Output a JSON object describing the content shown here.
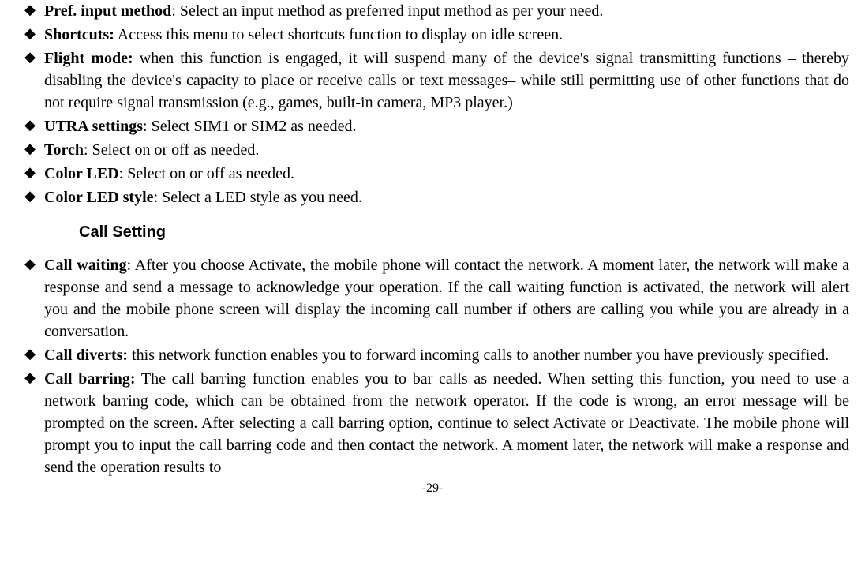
{
  "items1": [
    {
      "label": "Pref. input method",
      "sep": ": ",
      "text": "Select an input method as preferred input method as per your need."
    },
    {
      "label": "Shortcuts:",
      "sep": " ",
      "text": "Access this menu to select shortcuts function to display on idle screen."
    },
    {
      "label": "Flight mode:",
      "sep": " ",
      "text": "when this function is engaged, it will suspend many of the device's signal transmitting functions – thereby disabling the device's capacity to place or receive calls or text messages– while still permitting use of other functions that do not require signal transmission (e.g., games, built-in camera, MP3 player.)"
    },
    {
      "label": "UTRA settings",
      "sep": ": ",
      "text": "Select SIM1 or SIM2 as needed."
    },
    {
      "label": "Torch",
      "sep": ": ",
      "text": "Select on or off as needed."
    },
    {
      "label": "Color LED",
      "sep": ": ",
      "text": "Select on or off as needed."
    },
    {
      "label": "Color LED style",
      "sep": ": ",
      "text": "Select a LED style as you need."
    }
  ],
  "heading": "Call Setting",
  "items2": [
    {
      "label": "Call waiting",
      "sep": ": ",
      "text": "After you choose Activate, the mobile phone will contact the network. A moment later, the network will make a response and send a message to acknowledge your operation. If the call waiting function is activated, the network will alert you and the mobile phone screen will display the incoming call number if others are calling you while you are already in a conversation."
    },
    {
      "label": "Call diverts:",
      "sep": " ",
      "text": "this network function enables you to forward incoming calls to another number you have previously specified."
    },
    {
      "label": "Call barring:",
      "sep": " ",
      "text": "The call barring function enables you to bar calls as needed. When setting this function, you need to use a network barring code, which can be obtained from the network operator. If the code is wrong, an error message will be prompted on the screen. After selecting a call barring option, continue to select Activate or Deactivate. The mobile phone will prompt you to input the call barring code and then contact the network. A moment later, the network will make a response and send the operation results to"
    }
  ],
  "pageNumber": "-29-",
  "bullet": "◆"
}
